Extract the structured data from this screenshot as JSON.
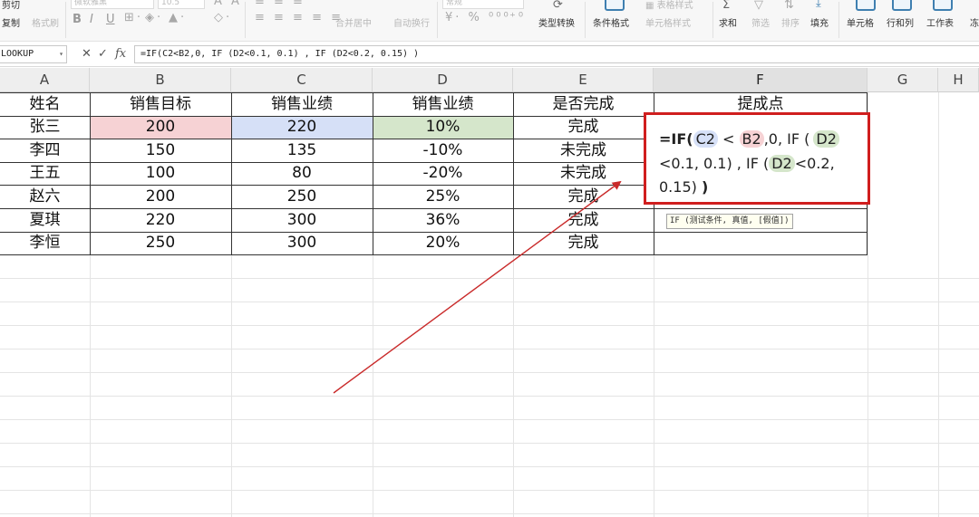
{
  "ribbon": {
    "clipboard": {
      "cut": "剪切",
      "copy": "复制",
      "format_painter": "格式刷"
    },
    "font": {
      "name": "微软雅黑",
      "size": "10.5",
      "bold": "B",
      "italic": "I",
      "underline": "U"
    },
    "alignment": {
      "merge_center": "合并居中",
      "wrap_text": "自动换行"
    },
    "number": {
      "format": "常规",
      "type_convert": "类型转换"
    },
    "styles": {
      "conditional_format": "条件格式",
      "cell_style": "单元格样式"
    },
    "editing": {
      "sum": "求和",
      "filter": "筛选",
      "sort": "排序",
      "fill": "填充"
    },
    "cells": {
      "cell": "单元格",
      "row_col": "行和列",
      "worksheet": "工作表",
      "extra": "冻"
    }
  },
  "formula_bar": {
    "name_box": "LOOKUP",
    "cancel": "✕",
    "enter": "✓",
    "fx": "fx",
    "formula": "=IF(C2<B2,0, IF (D2<0.1, 0.1) , IF (D2<0.2, 0.15) )"
  },
  "columns": [
    "A",
    "B",
    "C",
    "D",
    "E",
    "F",
    "G",
    "H"
  ],
  "active_column": "F",
  "table": {
    "headers": [
      "姓名",
      "销售目标",
      "销售业绩",
      "销售业绩",
      "是否完成",
      "提成点"
    ],
    "rows": [
      [
        "张三",
        "200",
        "220",
        "10%",
        "完成"
      ],
      [
        "李四",
        "150",
        "135",
        "-10%",
        "未完成"
      ],
      [
        "王五",
        "100",
        "80",
        "-20%",
        "未完成"
      ],
      [
        "赵六",
        "200",
        "250",
        "25%",
        "完成"
      ],
      [
        "夏琪",
        "220",
        "300",
        "36%",
        "完成"
      ],
      [
        "李恒",
        "250",
        "300",
        "20%",
        "完成"
      ]
    ]
  },
  "edit_overlay": {
    "line1": {
      "eq_if": "=IF(",
      "ref_c2": "C2",
      "lt": " < ",
      "ref_b2": "B2",
      "tail": ",0, IF (",
      "ref_d2": "D2"
    },
    "line2": {
      "text": "<0.1, 0.1) , IF (",
      "ref_d2": "D2",
      "tail": "<0.2,"
    },
    "line3": {
      "text": "0.15) ",
      "close": ")"
    },
    "tooltip": "IF (测试条件, 真值, [假值])"
  },
  "colors": {
    "accent_red": "#d01e1e",
    "arrow": "#c92a2a",
    "ref_c2_fill": "#d6e0f7",
    "ref_b2_fill": "#f6d2d4",
    "ref_d2_fill": "#d5e6cb"
  },
  "icons": [
    "dropdown-chevron-icon",
    "cancel-icon",
    "enter-check-icon",
    "fx-icon",
    "annotation-arrow"
  ]
}
